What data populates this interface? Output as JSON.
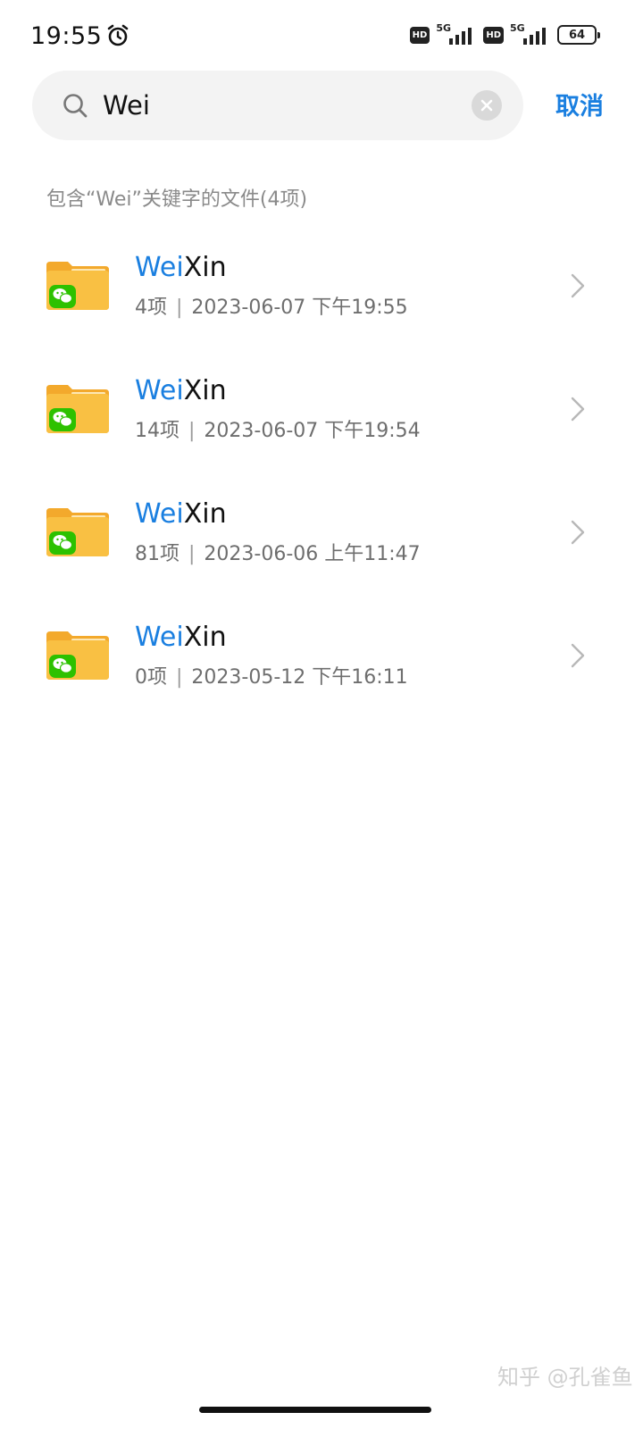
{
  "status_bar": {
    "time": "19:55",
    "hd_1": "HD",
    "net_1": "5G",
    "hd_2": "HD",
    "net_2": "5G",
    "battery": "64",
    "icons": [
      "alarm-icon",
      "signal-icon",
      "battery-icon"
    ]
  },
  "search": {
    "query": "Wei",
    "cancel_label": "取消"
  },
  "results_header": "包含“Wei”关键字的文件(4项)",
  "items": [
    {
      "name_match": "Wei",
      "name_rest": "Xin",
      "count": "4项",
      "date": "2023-06-07 下午19:55"
    },
    {
      "name_match": "Wei",
      "name_rest": "Xin",
      "count": "14项",
      "date": "2023-06-07 下午19:54"
    },
    {
      "name_match": "Wei",
      "name_rest": "Xin",
      "count": "81项",
      "date": "2023-06-06 上午11:47"
    },
    {
      "name_match": "Wei",
      "name_rest": "Xin",
      "count": "0项",
      "date": "2023-05-12 下午16:11"
    }
  ],
  "separator": "|",
  "watermark": "知乎 @孔雀鱼",
  "colors": {
    "accent": "#1a7fe0",
    "folder": "#f9c043",
    "wechat": "#2dc100"
  }
}
